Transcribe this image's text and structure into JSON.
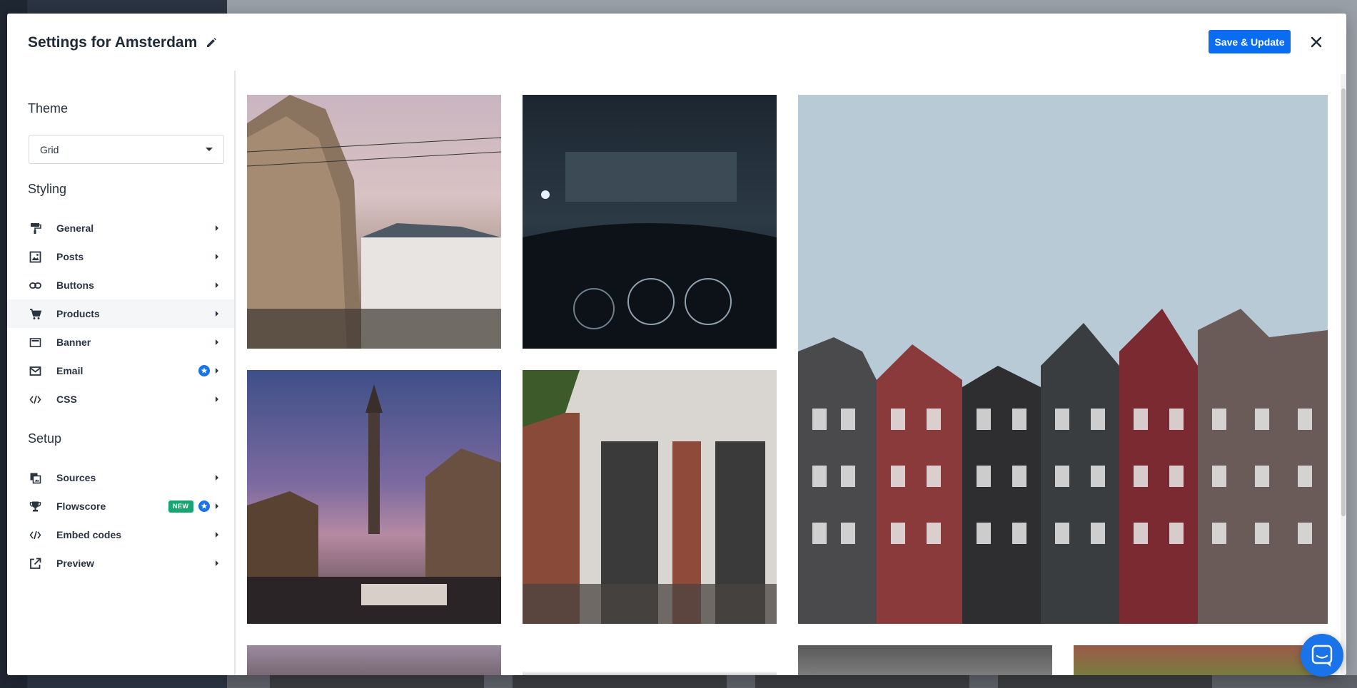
{
  "header": {
    "title": "Settings for Amsterdam",
    "save_label": "Save & Update"
  },
  "sidebar": {
    "theme_title": "Theme",
    "theme_select_value": "Grid",
    "styling_title": "Styling",
    "styling_items": [
      {
        "label": "General",
        "icon": "paint-roller-icon"
      },
      {
        "label": "Posts",
        "icon": "image-icon"
      },
      {
        "label": "Buttons",
        "icon": "link-icon"
      },
      {
        "label": "Products",
        "icon": "cart-icon"
      },
      {
        "label": "Banner",
        "icon": "banner-icon"
      },
      {
        "label": "Email",
        "icon": "mail-icon"
      },
      {
        "label": "CSS",
        "icon": "code-icon"
      }
    ],
    "setup_title": "Setup",
    "setup_items": [
      {
        "label": "Sources",
        "icon": "sources-icon"
      },
      {
        "label": "Flowscore",
        "icon": "trophy-icon",
        "badge": "NEW"
      },
      {
        "label": "Embed codes",
        "icon": "code-icon"
      },
      {
        "label": "Preview",
        "icon": "external-link-icon"
      }
    ]
  },
  "colors": {
    "primary": "#0a6cf0",
    "badge_new": "#17a673",
    "text": "#2a3441"
  }
}
